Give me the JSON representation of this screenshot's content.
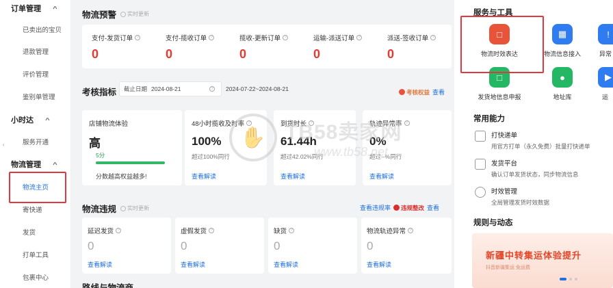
{
  "sidebar": {
    "groups": [
      {
        "label": "订单管理",
        "items": [
          "已卖出的宝贝",
          "退款管理",
          "评价管理",
          "鉴别单管理"
        ]
      },
      {
        "label": "小时达",
        "items": [
          "服务开通"
        ]
      },
      {
        "label": "物流管理",
        "items": [
          "物流主页",
          "寄快递",
          "发货",
          "打单工具",
          "包裹中心"
        ]
      }
    ],
    "active_item": "物流主页",
    "handle_glyph": "‹"
  },
  "alerts": {
    "title": "物流预警",
    "subtitle": "实时更新",
    "metrics": [
      {
        "label": "支付-发货订单",
        "value": "0"
      },
      {
        "label": "支付-揽收订单",
        "value": "0"
      },
      {
        "label": "揽收-更新订单",
        "value": "0"
      },
      {
        "label": "运输-派送订单",
        "value": "0"
      },
      {
        "label": "派送-签收订单",
        "value": "0"
      }
    ]
  },
  "kpi": {
    "title": "考核指标",
    "deadline_label": "截止日期",
    "deadline_value": "2024-08-21",
    "range_value": "2024-07-22~2024-08-21",
    "badge": "考核权益",
    "view_link": "查看",
    "cards": [
      {
        "title": "店铺物流体验",
        "value": "高",
        "score": "5分",
        "progress": 1.0,
        "note": "分数越高权益越多!"
      },
      {
        "title": "48小时揽收及时率",
        "value": "100%",
        "sub": "超过100%同行",
        "link": "查看解读"
      },
      {
        "title": "到货时长",
        "value": "61.44h",
        "sub": "超过42.02%同行",
        "link": "查看解读"
      },
      {
        "title": "轨迹异常率",
        "value": "0%",
        "sub": "超过--%同行",
        "link": "查看解读"
      }
    ]
  },
  "violations": {
    "title": "物流违规",
    "subtitle": "实时更新",
    "report_link": "查看违规率",
    "badge": "违规整改",
    "view_link": "查看",
    "cards": [
      {
        "title": "延迟发货",
        "value": "0",
        "link": "查看解读"
      },
      {
        "title": "虚假发货",
        "value": "0",
        "link": "查看解读"
      },
      {
        "title": "缺货",
        "value": "0",
        "link": "查看解读"
      },
      {
        "title": "物流轨迹异常",
        "value": "0",
        "link": "查看解读"
      }
    ]
  },
  "bottom_section": {
    "title": "路线与物流商"
  },
  "tools": {
    "title": "服务与工具",
    "items": [
      {
        "label": "物流时效表达",
        "icon": "clock-doc-icon",
        "color": "#e8543a"
      },
      {
        "label": "物流信息接入",
        "icon": "chart-doc-icon",
        "color": "#2f7bf0"
      },
      {
        "label": "异常",
        "icon": "alert-icon",
        "color": "#2f7bf0"
      },
      {
        "label": "发货地信息申报",
        "icon": "map-doc-icon",
        "color": "#25b864"
      },
      {
        "label": "地址库",
        "icon": "location-pin-icon",
        "color": "#25b864"
      },
      {
        "label": "运",
        "icon": "truck-icon",
        "color": "#2f7bf0"
      }
    ]
  },
  "abilities": {
    "title": "常用能力",
    "items": [
      {
        "title": "打快递单",
        "desc": "用官方打单（永久免费）批量打快递单"
      },
      {
        "title": "发货平台",
        "desc": "确认订单发货状态，同步物流信息"
      },
      {
        "title": "时效管理",
        "desc": "全局管理发货时效数据"
      }
    ]
  },
  "rules": {
    "title": "规则与动态",
    "banner_title": "新疆中转集运体验提升",
    "banner_sub": "抖音新疆集运 免运费"
  },
  "watermark": {
    "text": "TB58卖家网",
    "url": "www.tb58.net",
    "glyph": "✋"
  }
}
